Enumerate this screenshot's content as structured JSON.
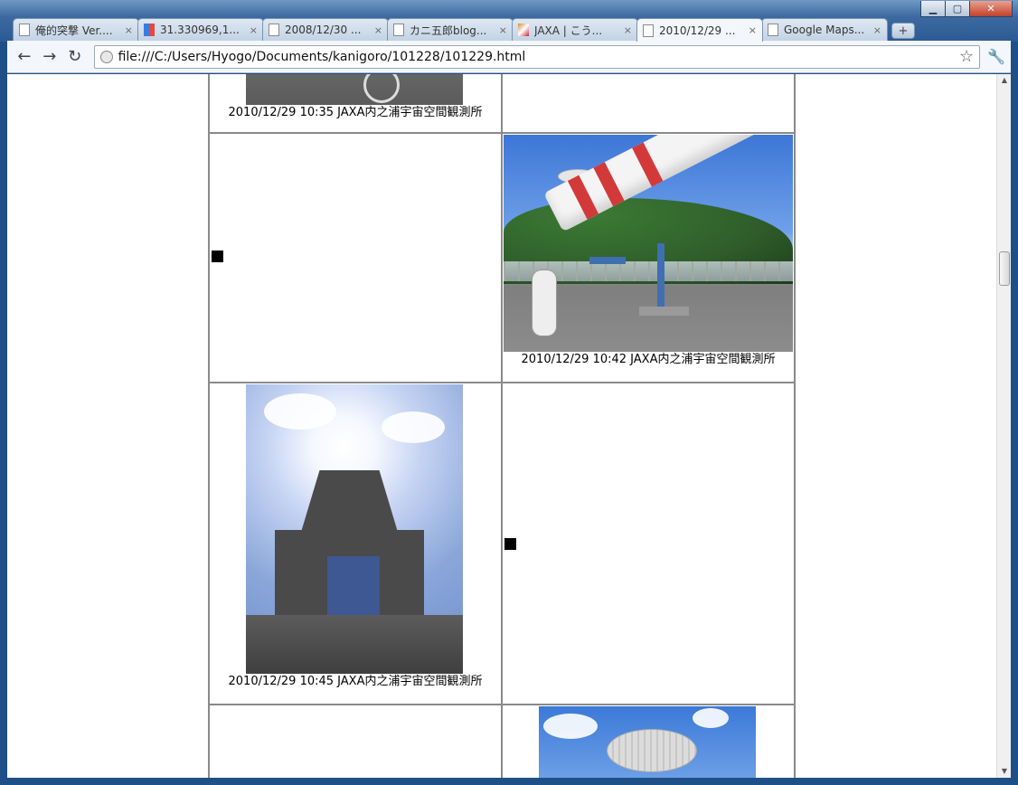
{
  "window": {
    "controls": {
      "minimize": "▁",
      "maximize": "▢",
      "close": "✕"
    }
  },
  "tabs": [
    {
      "title": "俺的突撃 Ver....",
      "icon": "page-icon",
      "active": false
    },
    {
      "title": "31.330969,1...",
      "icon": "google-icon",
      "active": false
    },
    {
      "title": "2008/12/30 ...",
      "icon": "page-icon",
      "active": false
    },
    {
      "title": "カニ五郎blog...",
      "icon": "page-icon",
      "active": false
    },
    {
      "title": "JAXA | こう...",
      "icon": "rocket-icon",
      "active": false
    },
    {
      "title": "2010/12/29 ...",
      "icon": "page-icon",
      "active": true
    },
    {
      "title": "Google Maps...",
      "icon": "page-icon",
      "active": false
    }
  ],
  "tab_close_glyph": "×",
  "new_tab_glyph": "+",
  "toolbar": {
    "back_glyph": "←",
    "forward_glyph": "→",
    "reload_glyph": "↻",
    "url": "file:///C:/Users/Hyogo/Documents/kanigoro/101228/101229.html",
    "star_glyph": "☆",
    "wrench_glyph": "🔧"
  },
  "photos": {
    "row1_left_caption": "2010/12/29 10:35 JAXA内之浦宇宙空間観測所",
    "row2_right_caption": "2010/12/29 10:42 JAXA内之浦宇宙空間観測所",
    "row3_left_caption": "2010/12/29 10:45 JAXA内之浦宇宙空間観測所"
  },
  "scrollbar": {
    "up": "▲",
    "down": "▼"
  }
}
